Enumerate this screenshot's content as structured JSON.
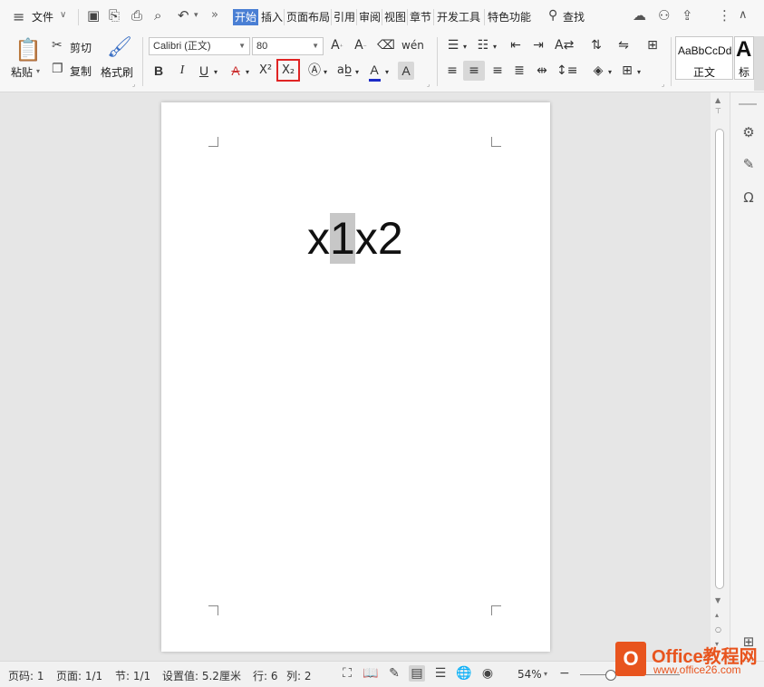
{
  "menubar": {
    "file_label": "文件",
    "tabs": [
      "开始",
      "插入",
      "页面布局",
      "引用",
      "审阅",
      "视图",
      "章节",
      "开发工具",
      "特色功能"
    ],
    "search_label": "查找",
    "more_icon": "chevron-double-right-icon"
  },
  "ribbon": {
    "paste_label": "粘贴",
    "cut_label": "剪切",
    "copy_label": "复制",
    "format_painter_label": "格式刷",
    "font_name": "Calibri (正文)",
    "font_size": "80",
    "bold": "B",
    "italic": "I",
    "underline": "U",
    "strike": "A",
    "superscript": "X²",
    "subscript": "X₂",
    "style_preview": "AaBbCcDd",
    "style_name": "正文",
    "style_next_preview": "A",
    "style_next_name": "标"
  },
  "document": {
    "text_before": "x",
    "text_selected": "1",
    "text_after": "x2"
  },
  "statusbar": {
    "page_no": "页码: 1",
    "page_count": "页面: 1/1",
    "section": "节: 1/1",
    "position": "设置值: 5.2厘米",
    "line": "行: 6",
    "column": "列: 2",
    "zoom": "54%"
  },
  "watermark": {
    "logo_letter": "O",
    "title": "Office教程网",
    "url": "www.office26.com"
  },
  "colors": {
    "active_tab": "#4a7fd4",
    "highlight_box": "#e02424",
    "font_color_bar": "#1c2bc7",
    "watermark": "#e8541e"
  }
}
